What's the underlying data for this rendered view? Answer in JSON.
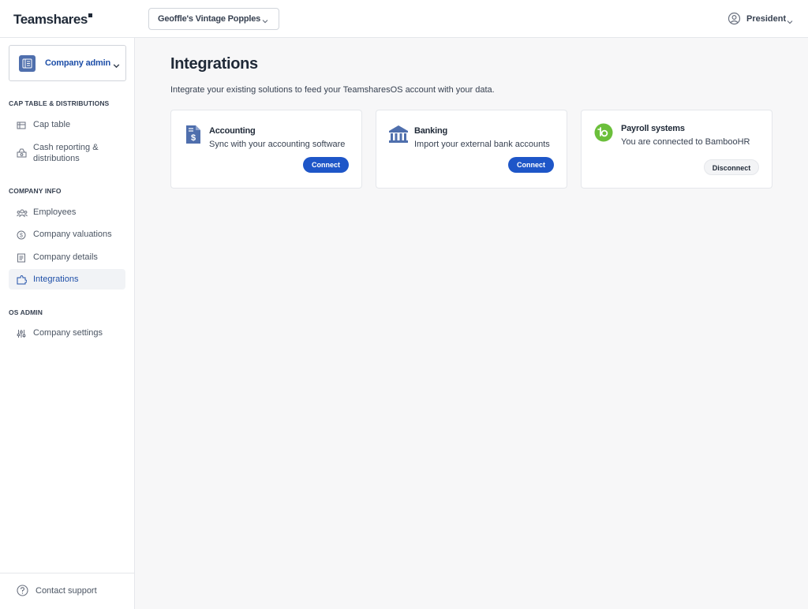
{
  "header": {
    "logo": "Teamshares",
    "company_name": "Geoffle's Vintage Popples",
    "user_role": "President"
  },
  "sidebar": {
    "role_select": "Company admin",
    "sections": [
      {
        "title": "CAP TABLE & DISTRIBUTIONS",
        "items": [
          {
            "label": "Cap table",
            "icon": "table-icon"
          },
          {
            "label": "Cash reporting & distributions",
            "icon": "money-bag-icon"
          }
        ]
      },
      {
        "title": "COMPANY INFO",
        "items": [
          {
            "label": "Employees",
            "icon": "people-icon"
          },
          {
            "label": "Company valuations",
            "icon": "dollar-circle-icon"
          },
          {
            "label": "Company details",
            "icon": "document-icon"
          },
          {
            "label": "Integrations",
            "icon": "puzzle-icon",
            "active": true
          }
        ]
      },
      {
        "title": "OS ADMIN",
        "items": [
          {
            "label": "Company settings",
            "icon": "sliders-icon"
          }
        ]
      }
    ],
    "footer": {
      "support_label": "Contact support"
    }
  },
  "main": {
    "title": "Integrations",
    "subtitle": "Integrate your existing solutions to feed your TeamsharesOS account with your data.",
    "cards": [
      {
        "title": "Accounting",
        "description": "Sync with your accounting software",
        "action": "Connect",
        "icon": "dollar-document-icon"
      },
      {
        "title": "Banking",
        "description": "Import your external bank accounts",
        "action": "Connect",
        "icon": "bank-icon"
      },
      {
        "title": "Payroll systems",
        "description": "You are connected to BambooHR",
        "action": "Disconnect",
        "icon": "bamboohr-logo-icon"
      }
    ]
  },
  "colors": {
    "accent": "#1e56c8",
    "active_text": "#1e4fa8",
    "bamboo_green": "#6bbf3b",
    "background": "#f7f7f8"
  }
}
